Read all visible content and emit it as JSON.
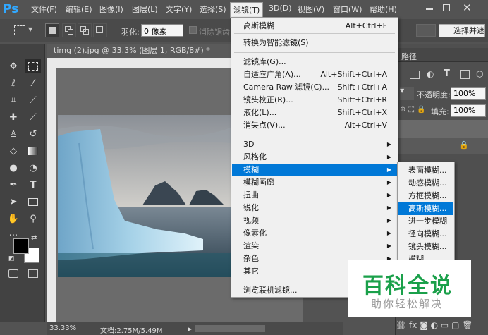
{
  "menubar": {
    "logo": "Ps",
    "items": [
      "文件(F)",
      "编辑(E)",
      "图像(I)",
      "图层(L)",
      "文字(Y)",
      "选择(S)",
      "滤镜(T)",
      "3D(D)",
      "视图(V)",
      "窗口(W)",
      "帮助(H)"
    ]
  },
  "options": {
    "feather_label": "羽化:",
    "feather_value": "0 像素",
    "antialias_label": "消除锯齿",
    "select_mask": "选择并遮"
  },
  "document": {
    "tab_title": "timg (2).jpg @ 33.3% (图层 1, RGB/8#) *",
    "close": "×"
  },
  "status": {
    "zoom": "33.33%",
    "doc": "文档:2.75M/5.49M"
  },
  "right_panel": {
    "tab": "路径",
    "opacity_label": "不透明度:",
    "opacity_value": "100%",
    "fill_label": "填充:",
    "fill_value": "100%"
  },
  "filter_menu": {
    "items": [
      {
        "label": "高斯模糊",
        "shortcut": "Alt+Ctrl+F"
      },
      {
        "label": "转换为智能滤镜(S)",
        "shortcut": ""
      },
      {
        "label": "滤镜库(G)...",
        "shortcut": ""
      },
      {
        "label": "自适应广角(A)...",
        "shortcut": "Alt+Shift+Ctrl+A"
      },
      {
        "label": "Camera Raw 滤镜(C)...",
        "shortcut": "Shift+Ctrl+A"
      },
      {
        "label": "镜头校正(R)...",
        "shortcut": "Shift+Ctrl+R"
      },
      {
        "label": "液化(L)...",
        "shortcut": "Shift+Ctrl+X"
      },
      {
        "label": "消失点(V)...",
        "shortcut": "Alt+Ctrl+V"
      },
      {
        "label": "3D",
        "shortcut": ""
      },
      {
        "label": "风格化",
        "shortcut": ""
      },
      {
        "label": "模糊",
        "shortcut": ""
      },
      {
        "label": "模糊画廊",
        "shortcut": ""
      },
      {
        "label": "扭曲",
        "shortcut": ""
      },
      {
        "label": "锐化",
        "shortcut": ""
      },
      {
        "label": "视频",
        "shortcut": ""
      },
      {
        "label": "像素化",
        "shortcut": ""
      },
      {
        "label": "渲染",
        "shortcut": ""
      },
      {
        "label": "杂色",
        "shortcut": ""
      },
      {
        "label": "其它",
        "shortcut": ""
      },
      {
        "label": "浏览联机滤镜...",
        "shortcut": ""
      }
    ]
  },
  "blur_submenu": {
    "items": [
      "表面模糊...",
      "动感模糊...",
      "方框模糊...",
      "高斯模糊...",
      "进一步模糊",
      "径向模糊...",
      "镜头模糊...",
      "模糊"
    ]
  },
  "watermark": {
    "title": "百科全说",
    "subtitle": "助你轻松解决"
  },
  "colors": {
    "highlight": "#0078d7",
    "ps_blue": "#31a8ff",
    "watermark_green": "#1aa04a"
  }
}
